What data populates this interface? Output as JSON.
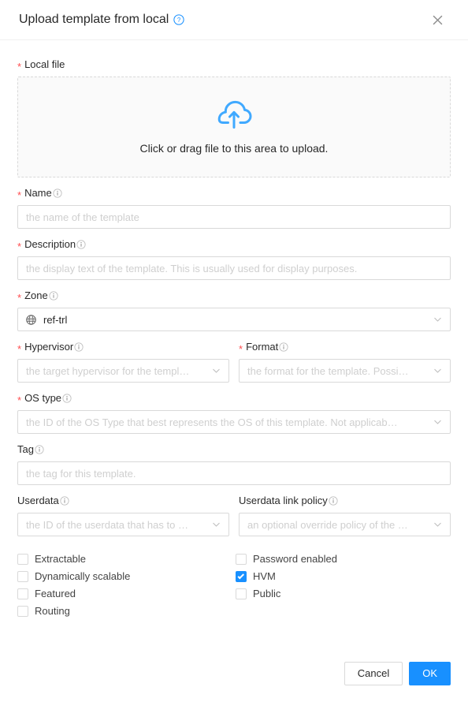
{
  "dialog": {
    "title": "Upload template from local",
    "title_help_icon": "question-circle-icon",
    "close_icon": "close-icon"
  },
  "fields": {
    "local_file": {
      "label": "Local file",
      "required": true,
      "info_icon": null,
      "dragger_icon": "cloud-upload-icon",
      "dragger_text": "Click or drag file to this area to upload."
    },
    "name": {
      "label": "Name",
      "required": true,
      "info_icon": "info-circle-icon",
      "value": "",
      "placeholder": "the name of the template"
    },
    "description": {
      "label": "Description",
      "required": true,
      "info_icon": "info-circle-icon",
      "value": "",
      "placeholder": "the display text of the template. This is usually used for display purposes."
    },
    "zone": {
      "label": "Zone",
      "required": true,
      "info_icon": "info-circle-icon",
      "prefix_icon": "globe-icon",
      "value": "ref-trl",
      "placeholder": ""
    },
    "hypervisor": {
      "label": "Hypervisor",
      "required": true,
      "info_icon": "info-circle-icon",
      "value": "",
      "placeholder": "the target hypervisor for the templ…"
    },
    "format": {
      "label": "Format",
      "required": true,
      "info_icon": "info-circle-icon",
      "value": "",
      "placeholder": "the format for the template. Possi…"
    },
    "os_type": {
      "label": "OS type",
      "required": true,
      "info_icon": "info-circle-icon",
      "value": "",
      "placeholder": "the ID of the OS Type that best represents the OS of this template. Not applicab…"
    },
    "tag": {
      "label": "Tag",
      "required": false,
      "info_icon": "info-circle-icon",
      "value": "",
      "placeholder": "the tag for this template."
    },
    "userdata": {
      "label": "Userdata",
      "required": false,
      "info_icon": "info-circle-icon",
      "value": "",
      "placeholder": "the ID of the userdata that has to …"
    },
    "userdata_link_policy": {
      "label": "Userdata link policy",
      "required": false,
      "info_icon": "info-circle-icon",
      "value": "",
      "placeholder": "an optional override policy of the …"
    }
  },
  "checkboxes": {
    "left": [
      {
        "label": "Extractable",
        "checked": false
      },
      {
        "label": "Dynamically scalable",
        "checked": false
      },
      {
        "label": "Featured",
        "checked": false
      },
      {
        "label": "Routing",
        "checked": false
      }
    ],
    "right": [
      {
        "label": "Password enabled",
        "checked": false
      },
      {
        "label": "HVM",
        "checked": true
      },
      {
        "label": "Public",
        "checked": false
      }
    ]
  },
  "footer": {
    "cancel_label": "Cancel",
    "ok_label": "OK"
  },
  "colors": {
    "primary": "#1890ff",
    "required_star": "#ff4d4f",
    "border": "#d9d9d9",
    "placeholder": "#cfcfcf",
    "dragger_bg": "#fafafa"
  }
}
